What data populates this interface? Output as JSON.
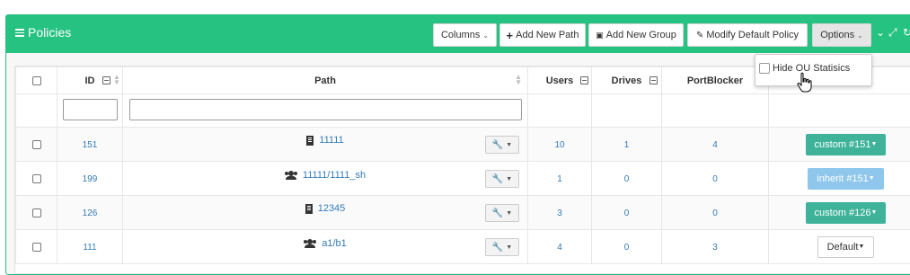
{
  "panel": {
    "title": "Policies"
  },
  "toolbar": {
    "columns": "Columns",
    "add_path": "Add New Path",
    "add_group": "Add New Group",
    "modify_default": "Modify Default Policy",
    "options": "Options"
  },
  "options_menu": {
    "hide_ou": "Hide OU Statisics"
  },
  "table": {
    "headers": {
      "id": "ID",
      "path": "Path",
      "users": "Users",
      "drives": "Drives",
      "portblocker": "PortBlocker"
    },
    "rows": [
      {
        "id": "151",
        "path_icon": "building-icon",
        "path": "11111",
        "users": "10",
        "drives": "1",
        "portblocker": "4",
        "policy": "custom #151",
        "policy_style": "custom"
      },
      {
        "id": "199",
        "path_icon": "users-icon",
        "path": "11111/1111_sh",
        "users": "1",
        "drives": "0",
        "portblocker": "0",
        "policy": "inherit #151",
        "policy_style": "inherit"
      },
      {
        "id": "126",
        "path_icon": "building-icon",
        "path": "12345",
        "users": "3",
        "drives": "0",
        "portblocker": "0",
        "policy": "custom #126",
        "policy_style": "custom"
      },
      {
        "id": "111",
        "path_icon": "users-icon",
        "path": "a1/b1",
        "users": "4",
        "drives": "0",
        "portblocker": "3",
        "policy": "Default",
        "policy_style": "default"
      }
    ]
  },
  "colors": {
    "header": "#26c281",
    "custom": "#3fb39a",
    "inherit": "#8fc7ec",
    "link": "#337ab7"
  }
}
